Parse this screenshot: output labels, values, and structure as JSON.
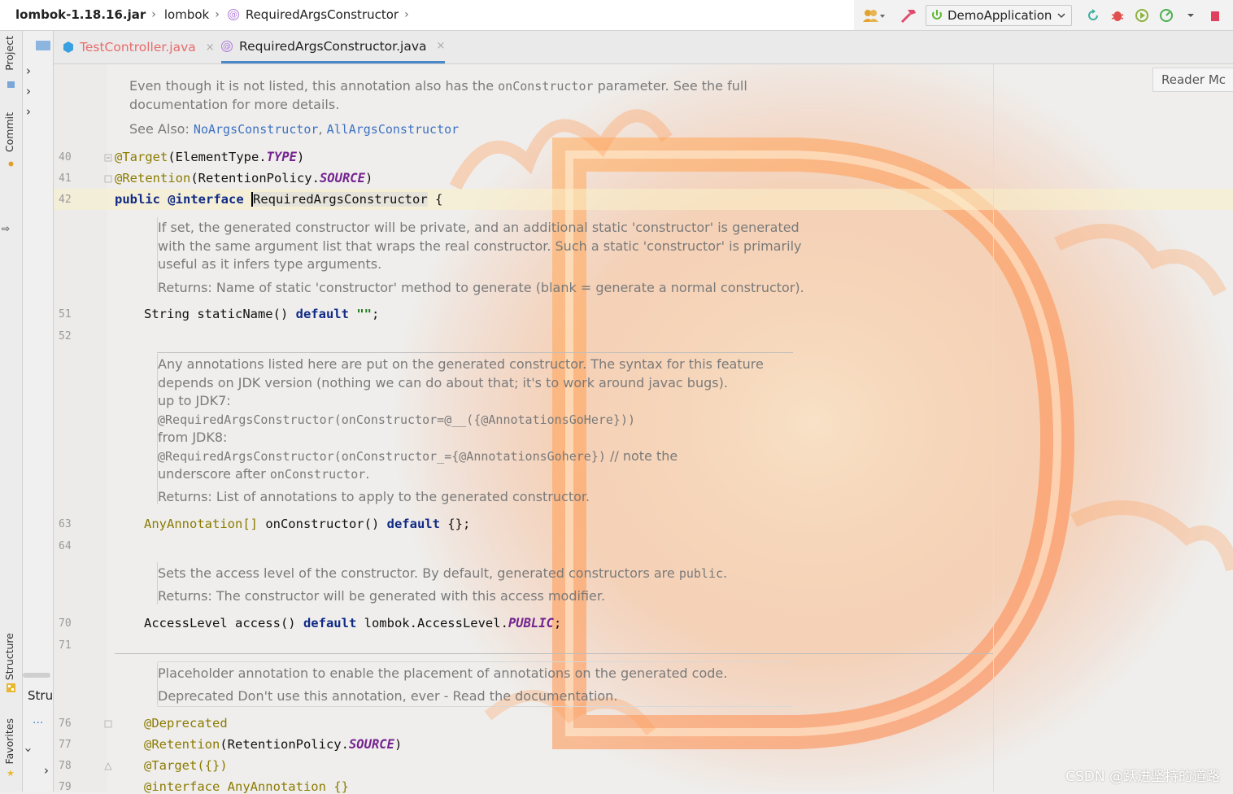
{
  "breadcrumb": {
    "jar": "lombok-1.18.16.jar",
    "package": "lombok",
    "class": "RequiredArgsConstructor",
    "sep": "›"
  },
  "toolbar": {
    "run_config": "DemoApplication",
    "reader_mode": "Reader Mc"
  },
  "left_strip": {
    "project_tab": "Project",
    "commit_tab": "Commit",
    "structure_tab": "Structure",
    "favorites_tab": "Favorites"
  },
  "project_panel": {
    "structure_header": "Stru"
  },
  "tabs": [
    {
      "label": "TestController.java",
      "close": "×"
    },
    {
      "label": "RequiredArgsConstructor.java",
      "close": "×"
    }
  ],
  "line_numbers": {
    "l40": "40",
    "l41": "41",
    "l42": "42",
    "l51": "51",
    "l52": "52",
    "l63": "63",
    "l64": "64",
    "l70": "70",
    "l71": "71",
    "l76": "76",
    "l77": "77",
    "l78": "78",
    "l79": "79"
  },
  "doc_top": {
    "line1_a": "Even though it is not listed, this annotation also has the ",
    "line1_code": "onConstructor",
    "line1_b": " parameter. See the full",
    "line2": "documentation for more details.",
    "see_also": "See Also: ",
    "link1": "NoArgsConstructor",
    "comma": ", ",
    "link2": "AllArgsConstructor"
  },
  "code": {
    "target_annot": "@Target",
    "target_open": "(ElementType.",
    "target_type": "TYPE",
    "target_close": ")",
    "retention_annot": "@Retention",
    "retention_open": "(RetentionPolicy.",
    "retention_source": "SOURCE",
    "retention_close": ")",
    "public_kw": "public",
    "interface_kw": "@interface",
    "class_name": "RequiredArgsConstructor",
    "open_brace": " {",
    "static_type": "String staticName() ",
    "default_kw": "default",
    "static_val": "\"\"",
    "semicolon": ";",
    "anyann_type": "AnyAnnotation[]",
    "onctor_sig": " onConstructor() ",
    "onctor_val": " {};",
    "access_sig": "AccessLevel access() ",
    "access_val_a": " lombok.AccessLevel.",
    "access_public": "PUBLIC",
    "deprecated": "@Deprecated",
    "target2_annot": "@Target",
    "target2_body": "({})",
    "interface2": "@interface AnyAnnotation {}"
  },
  "doc_static": {
    "line1": "If set, the generated constructor will be private, and an additional static 'constructor' is generated",
    "line2": "with the same argument list that wraps the real constructor. Such a static 'constructor' is primarily",
    "line3": "useful as it infers type arguments.",
    "returns": "Returns: Name of static 'constructor' method to generate (blank = generate a normal constructor)."
  },
  "doc_onctor": {
    "line1": "Any annotations listed here are put on the generated constructor. The syntax for this feature",
    "line2": "depends on JDK version (nothing we can do about that; it's to work around javac bugs).",
    "line3": "up to JDK7:",
    "line4": "@RequiredArgsConstructor(onConstructor=@__({@AnnotationsGoHere}))",
    "line5": "from JDK8:",
    "line6_code": "@RequiredArgsConstructor(onConstructor_={@AnnotationsGohere})",
    "line6_b": " // note the",
    "line7_a": "underscore after ",
    "line7_code": "onConstructor",
    "line7_b": ".",
    "returns": "Returns: List of annotations to apply to the generated constructor."
  },
  "doc_access": {
    "line1_a": "Sets the access level of the constructor. By default, generated constructors are ",
    "line1_code": "public",
    "line1_b": ".",
    "returns": "Returns: The constructor will be generated with this access modifier."
  },
  "doc_anyann": {
    "line1": "Placeholder annotation to enable the placement of annotations on the generated code.",
    "line2": "Deprecated Don't use this annotation, ever - Read the documentation."
  },
  "watermark": "CSDN @跃进坚持的道路",
  "colors": {
    "keyword": "#102a86",
    "annotation": "#8b7b00",
    "constant": "#74248f",
    "doc_text": "#7a7a7a",
    "link": "#3d72c4",
    "modified_tab": "#e86b6b"
  },
  "icons": {
    "breadcrumb_class": "annotation-icon",
    "tab_test": "java-class-icon",
    "tab_req": "annotation-icon"
  }
}
